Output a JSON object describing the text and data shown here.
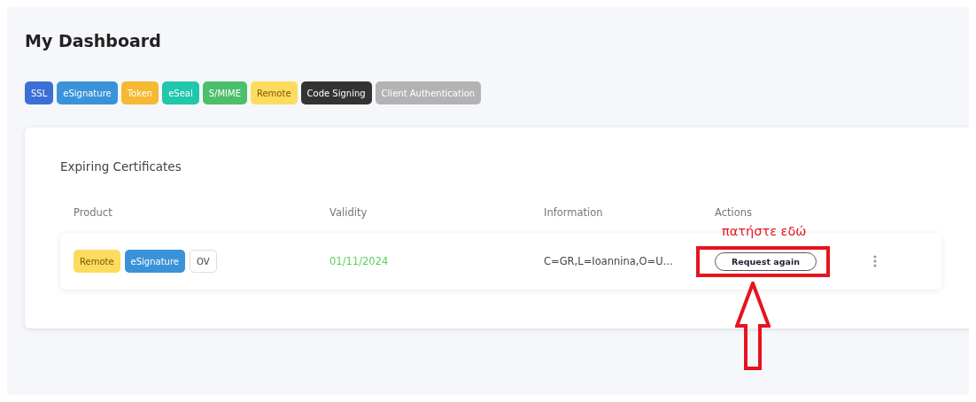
{
  "title": "My Dashboard",
  "filters": [
    {
      "label": "SSL",
      "color": "#3b6fd6"
    },
    {
      "label": "eSignature",
      "color": "#3a93d9"
    },
    {
      "label": "Token",
      "color": "#f5b932"
    },
    {
      "label": "eSeal",
      "color": "#1fc7ab"
    },
    {
      "label": "S/MIME",
      "color": "#4bbf6b"
    },
    {
      "label": "Remote",
      "color": "#fddb5e"
    },
    {
      "label": "Code Signing",
      "color": "#333333"
    },
    {
      "label": "Client Authentication",
      "color": "#b3b3b3"
    }
  ],
  "card": {
    "title": "Expiring Certificates",
    "columns": [
      "Product",
      "Validity",
      "Information",
      "Actions"
    ],
    "rows": [
      {
        "products": [
          {
            "label": "Remote",
            "color": "#fddb5e"
          },
          {
            "label": "eSignature",
            "color": "#3a93d9"
          },
          {
            "label": "OV",
            "color": "#ffffff"
          }
        ],
        "validity": "01/11/2024",
        "information": "C=GR,L=Ioannina,O=U...",
        "action": "Request again"
      }
    ]
  },
  "annotation": {
    "label": "πατήστε εδώ"
  }
}
